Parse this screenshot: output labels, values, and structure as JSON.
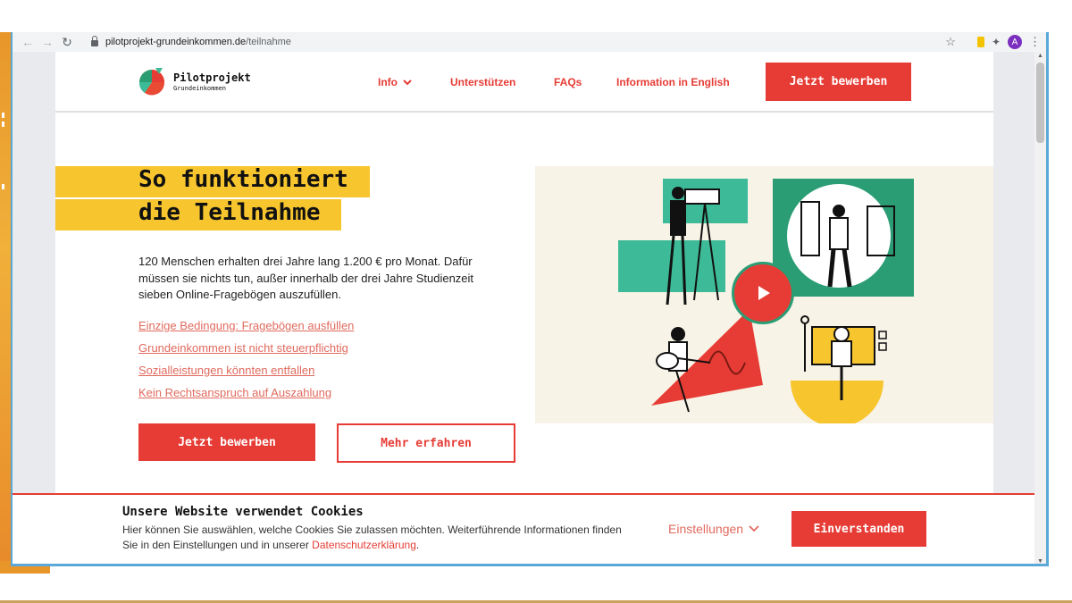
{
  "browser": {
    "url_host": "pilotprojekt-grundeinkommen.de",
    "url_path": "/teilnahme",
    "profile_initial": "A"
  },
  "site": {
    "logo_line1": "Pilotprojekt",
    "logo_line2": "Grundeinkommen",
    "nav": {
      "info": "Info",
      "support": "Unterstützen",
      "faqs": "FAQs",
      "english": "Information in English"
    },
    "cta_top": "Jetzt bewerben"
  },
  "hero": {
    "heading_line1": "So funktioniert",
    "heading_line2": "die Teilnahme",
    "intro": "120 Menschen erhalten drei Jahre lang 1.200 € pro Monat. Dafür müssen sie nichts tun, außer innerhalb der drei Jahre Studienzeit sieben Online-Fragebögen auszufüllen.",
    "links": [
      "Einzige Bedingung: Fragebögen ausfüllen",
      "Grundeinkommen ist nicht steuerpflichtig",
      "Sozialleistungen könnten entfallen",
      "Kein Rechtsanspruch auf Auszahlung"
    ],
    "btn_apply": "Jetzt bewerben",
    "btn_more": "Mehr erfahren"
  },
  "cookie": {
    "title": "Unsere Website verwendet Cookies",
    "text": "Hier können Sie auswählen, welche Cookies Sie zulassen möchten. Weiterführende Informationen finden Sie in den Einstellungen und in unserer ",
    "link": "Datenschutzerklärung",
    "text_end": ".",
    "settings": "Einstellungen",
    "accept": "Einverstanden"
  },
  "colors": {
    "accent": "#e63c35",
    "highlight": "#f7c52e",
    "teal": "#3dba97"
  }
}
